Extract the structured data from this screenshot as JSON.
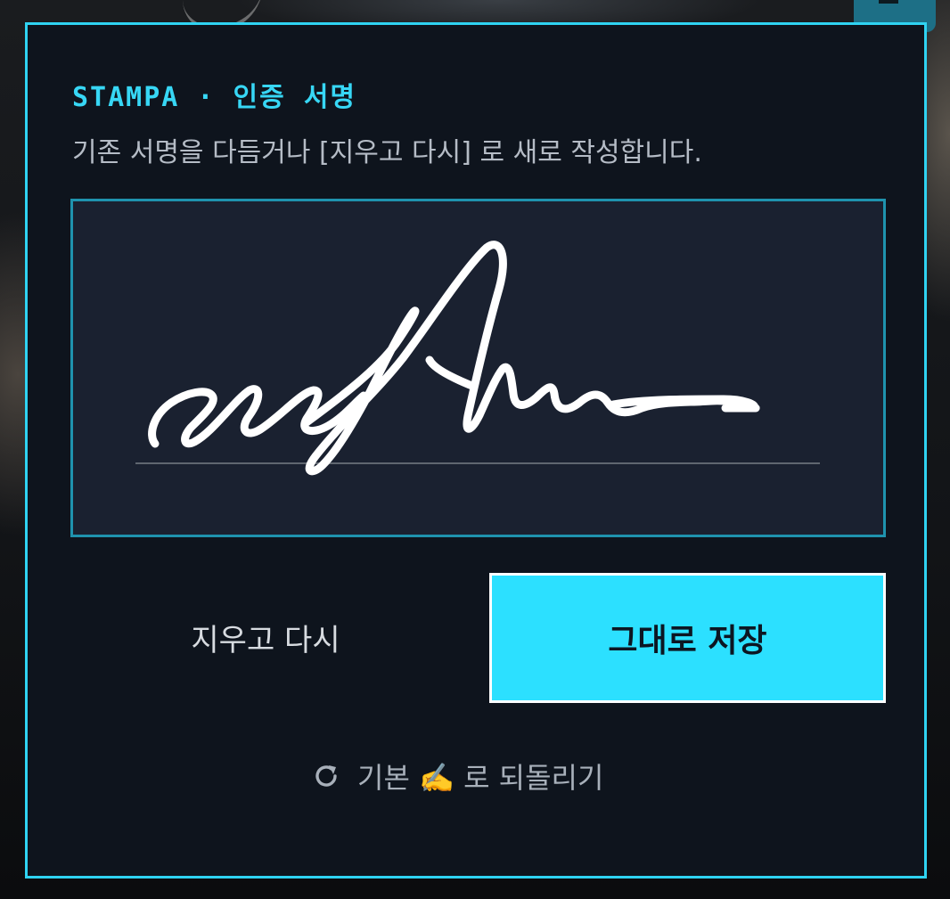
{
  "dialog": {
    "eyebrow": "STAMPA · 인증 서명",
    "subtitle": "기존 서명을 다듬거나 [지우고 다시] 로 새로 작성합니다."
  },
  "actions": {
    "clear_label": "지우고 다시",
    "save_label": "그대로 저장",
    "reset_label": "기본 ✍️ 로 되돌리기",
    "reset_icon": "refresh-icon"
  },
  "colors": {
    "accent": "#2fd3f2",
    "save_button_bg": "#2ce0ff",
    "modal_bg": "#0e141d",
    "signature_pad_bg": "#1a2130",
    "ink": "#ffffff"
  }
}
